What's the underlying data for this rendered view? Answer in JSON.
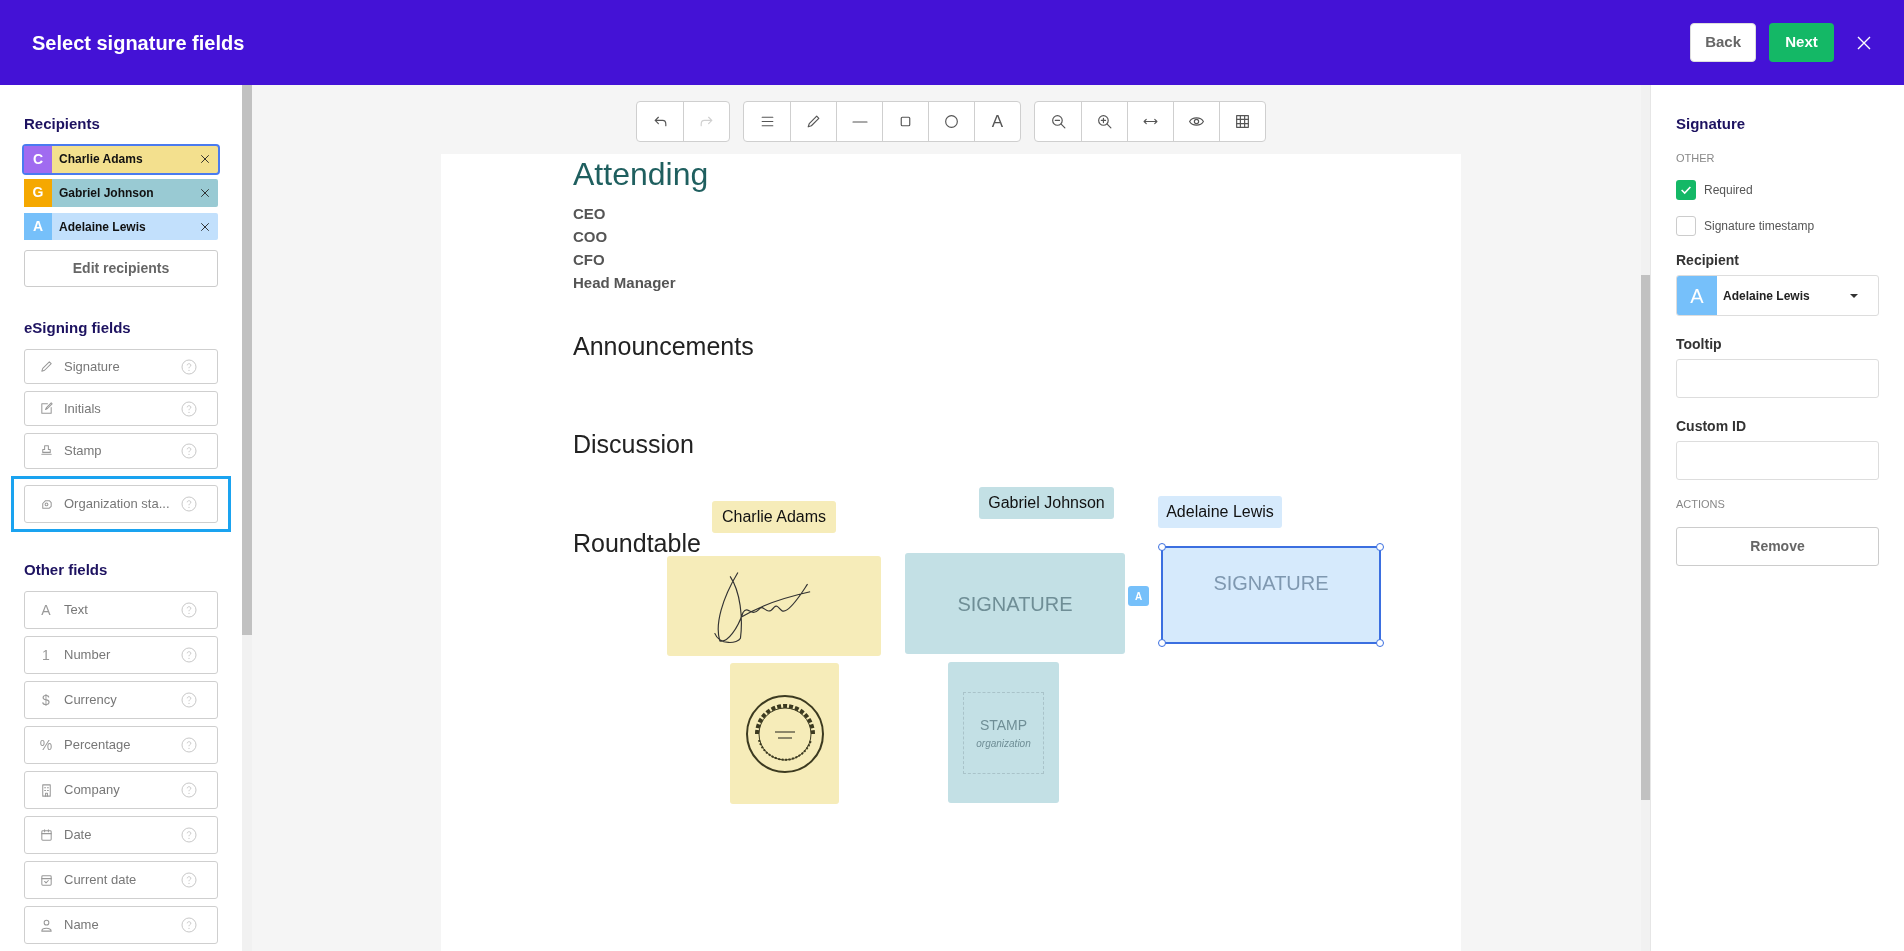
{
  "header": {
    "title": "Select signature fields",
    "buttons": [
      {
        "label": "Back",
        "kind": "secondary"
      },
      {
        "label": "Next",
        "kind": "primary"
      }
    ]
  },
  "sidebar": {
    "recipients_heading": "Recipients",
    "recipients": [
      {
        "initial": "C",
        "name": "Charlie Adams",
        "color": "#a06bf0",
        "selected": true
      },
      {
        "initial": "G",
        "name": "Gabriel Johnson",
        "color": "#f5a800",
        "selected": false
      },
      {
        "initial": "A",
        "name": "Adelaine Lewis",
        "color": "#76c0fa",
        "selected": false
      }
    ],
    "edit_button": "Edit recipients",
    "esigning_heading": "eSigning fields",
    "esigning_fields": [
      {
        "label": "Signature",
        "highlighted": false
      },
      {
        "label": "Initials",
        "highlighted": false
      },
      {
        "label": "Stamp",
        "highlighted": false
      },
      {
        "label": "Organization sta...",
        "highlighted": true
      }
    ],
    "other_heading": "Other fields",
    "other_fields": [
      {
        "label": "Text",
        "glyph": "A"
      },
      {
        "label": "Number",
        "glyph": "1"
      },
      {
        "label": "Currency",
        "glyph": "$"
      },
      {
        "label": "Percentage",
        "glyph": "%"
      },
      {
        "label": "Company"
      },
      {
        "label": "Date"
      },
      {
        "label": "Current date"
      },
      {
        "label": "Name"
      }
    ]
  },
  "toolbar": [
    {
      "buttons": [
        {
          "disabled": false
        },
        {
          "disabled": true
        }
      ]
    },
    {
      "buttons": [
        {
          "disabled": false
        },
        {
          "disabled": false
        },
        {
          "disabled": false
        },
        {
          "disabled": false
        },
        {
          "disabled": false
        },
        {
          "disabled": false,
          "glyph": "A"
        }
      ]
    },
    {
      "buttons": [
        {
          "disabled": false
        },
        {
          "disabled": false
        },
        {
          "disabled": false
        },
        {
          "disabled": false
        },
        {
          "disabled": false
        }
      ]
    }
  ],
  "document": {
    "title": "Attending",
    "attendees": [
      "CEO",
      "COO",
      "CFO",
      "Head Manager"
    ],
    "sections": [
      "Announcements",
      "Discussion",
      "Roundtable"
    ],
    "canvas_items": [
      {
        "kind": "name-tag",
        "text": "Charlie Adams",
        "color": "#f6ecb9",
        "selected": false
      },
      {
        "kind": "drawn-signature",
        "color": "#f6ecb9",
        "selected": false
      },
      {
        "kind": "seal",
        "color": "#f6ecb9",
        "selected": false
      },
      {
        "kind": "name-tag",
        "text": "Gabriel Johnson",
        "color": "#c3e0e5",
        "selected": false
      },
      {
        "kind": "signature-placeholder",
        "text": "SIGNATURE",
        "color": "#c3e0e5",
        "selected": false
      },
      {
        "kind": "stamp-placeholder",
        "text": "STAMP",
        "subtext": "organization",
        "color": "#c3e0e5",
        "selected": false
      },
      {
        "kind": "recipient-badge",
        "text": "A",
        "color": "#76c0fa",
        "selected": false
      },
      {
        "kind": "name-tag",
        "text": "Adelaine Lewis",
        "color": "#d6eafc",
        "selected": false
      },
      {
        "kind": "signature-placeholder",
        "text": "SIGNATURE",
        "color": "#d6eafc",
        "selected": true
      }
    ]
  },
  "properties": {
    "title": "Signature",
    "other_heading": "OTHER",
    "options": [
      {
        "label": "Required",
        "checked": true
      },
      {
        "label": "Signature timestamp",
        "checked": false
      }
    ],
    "recipient_label": "Recipient",
    "recipient": {
      "initial": "A",
      "name": "Adelaine Lewis",
      "color": "#76c0fa"
    },
    "tooltip_label": "Tooltip",
    "custom_id_label": "Custom ID",
    "actions_heading": "ACTIONS",
    "remove_button": "Remove"
  }
}
